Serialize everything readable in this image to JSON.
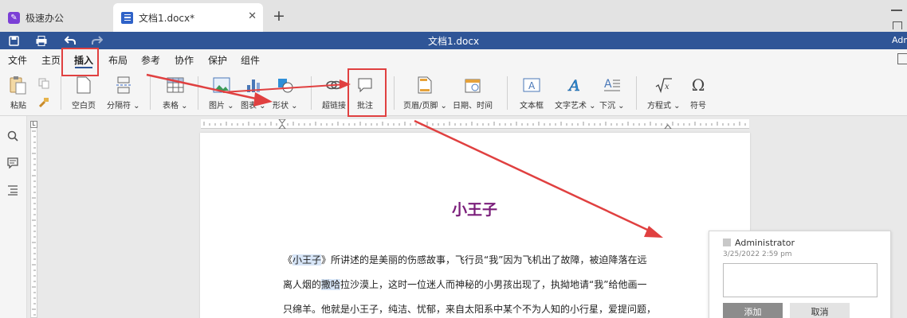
{
  "tabs": [
    {
      "label": "极速办公",
      "icon": "app-logo-icon"
    },
    {
      "label": "文档1.docx*",
      "icon": "document-icon"
    }
  ],
  "titlebar": {
    "title": "文档1.docx",
    "user": "Adm"
  },
  "menu": [
    "文件",
    "主页",
    "插入",
    "布局",
    "参考",
    "协作",
    "保护",
    "组件"
  ],
  "active_menu": "插入",
  "ribbon": {
    "paste": "粘贴",
    "blank_page": "空白页",
    "break": "分隔符",
    "table": "表格",
    "image": "图片",
    "chart": "图表",
    "shape": "形状",
    "hyperlink": "超链接",
    "comment": "批注",
    "header_footer": "页眉/页脚",
    "datetime": "日期、时间",
    "textbox": "文本框",
    "text_art": "文字艺术",
    "dropcap": "下沉",
    "equation": "方程式",
    "symbol": "符号"
  },
  "ruler": {
    "corner": "L"
  },
  "document": {
    "title": "小王子",
    "lines": {
      "l1_a": "《",
      "l1_hl": "小王子",
      "l1_b": "》所讲述的是美丽的伤感故事，飞行员“我”因为飞机出了故障，被迫降落在远",
      "l2_a": "离人烟的",
      "l2_hl": "撒哈",
      "l2_b": "拉沙漠上，这时一位迷人而神秘的小男孩出现了，执拗地请“我”给他画一",
      "l3": "只绵羊。他就是小王子，纯洁、忧郁，来自太阳系中某个不为人知的小行星，爱提问题，"
    }
  },
  "comment": {
    "author": "Administrator",
    "date": "3/25/2022 2:59 pm",
    "input_value": "",
    "add_label": "添加",
    "cancel_label": "取消"
  },
  "colors": {
    "titlebar": "#2f5597",
    "doc_title": "#7a1d7a",
    "annotation": "#e04040",
    "highlight": "#d7e5f7"
  }
}
